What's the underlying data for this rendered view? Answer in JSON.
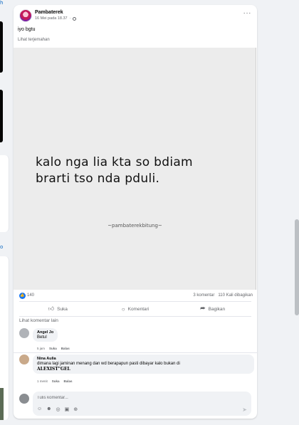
{
  "left_edge": {
    "top_link": "h",
    "mid_link": "o"
  },
  "post": {
    "author": "Pambaterek",
    "date": "16 Mei pada 18.37",
    "text": "iyo bgtu",
    "translate_label": "Lihat terjemahan",
    "image_lines": [
      "kalo nga lia kta so bdiam",
      "brarti tso nda pduli."
    ],
    "watermark": "~pambaterekbitung~",
    "reactions_count": "140",
    "comments_count": "3 komentar",
    "shares_count": "110 Kali dibagikan",
    "actions": {
      "like": "Suka",
      "comment": "Komentari",
      "share": "Bagikan"
    },
    "more_comments": "Lihat komentar lain"
  },
  "comments": [
    {
      "name": "Angel Jo",
      "text": "Betul",
      "time": "5 jam",
      "like": "Suka",
      "reply": "Balas"
    },
    {
      "name": "Nina Aulia",
      "text": "dimana lagi jaminan menang dan wd berapapun pasti dibayar kalo bukan di",
      "text_bold": "ALEXIST\"GEL",
      "time": "1 menit",
      "like": "Suka",
      "reply": "Balas"
    }
  ],
  "composer": {
    "placeholder": "Tulis komentar..."
  },
  "colors": {
    "accent": "#1877f2",
    "background": "#f0f2f5",
    "image_bg": "#ececec"
  },
  "icons": [
    "globe-icon",
    "more-icon",
    "like-icon",
    "comment-icon",
    "share-icon",
    "emoji-icon",
    "camera-icon",
    "gif-icon",
    "sticker-icon",
    "send-icon"
  ]
}
